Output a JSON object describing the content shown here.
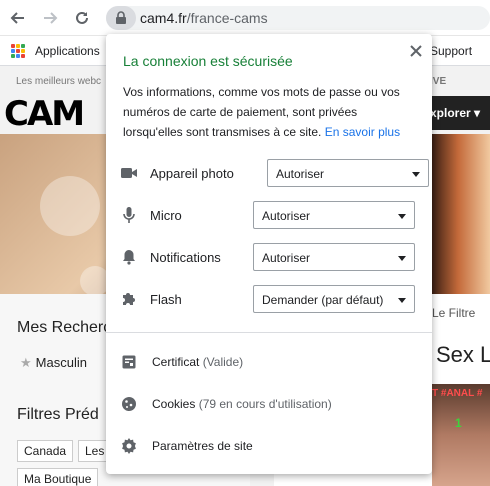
{
  "browser": {
    "url_domain": "cam4.fr",
    "url_path": "/france-cams"
  },
  "bookmarks": {
    "apps_label": "Applications",
    "support_label": "Support"
  },
  "site": {
    "tagline": "Les meilleurs webc",
    "tagline_right": "IVE",
    "logo": "CAM",
    "explorer_label": "xplorer",
    "search_title": "Mes Recherc",
    "masculine_label": "Masculin",
    "filters_title": "Filtres Préd",
    "chips": [
      "Canada",
      "Les",
      "Ma Boutique"
    ],
    "filtre_label": "Le Filtre",
    "sex_label": "Sex L",
    "thumb_tag": "T #ANAL #",
    "thumb_count": "1"
  },
  "popup": {
    "title": "La connexion est sécurisée",
    "description": "Vos informations, comme vos mots de passe ou vos numéros de carte de paiement, sont privées lorsqu'elles sont transmises à ce site.",
    "learn_more": "En savoir plus",
    "permissions": [
      {
        "label": "Appareil photo",
        "value": "Autoriser",
        "icon": "camera-icon"
      },
      {
        "label": "Micro",
        "value": "Autoriser",
        "icon": "microphone-icon"
      },
      {
        "label": "Notifications",
        "value": "Autoriser",
        "icon": "bell-icon"
      },
      {
        "label": "Flash",
        "value": "Demander (par défaut)",
        "icon": "puzzle-icon"
      }
    ],
    "certificate_label": "Certificat",
    "certificate_status": "(Valide)",
    "cookies_label": "Cookies",
    "cookies_status": "(79 en cours d'utilisation)",
    "site_settings_label": "Paramètres de site"
  }
}
